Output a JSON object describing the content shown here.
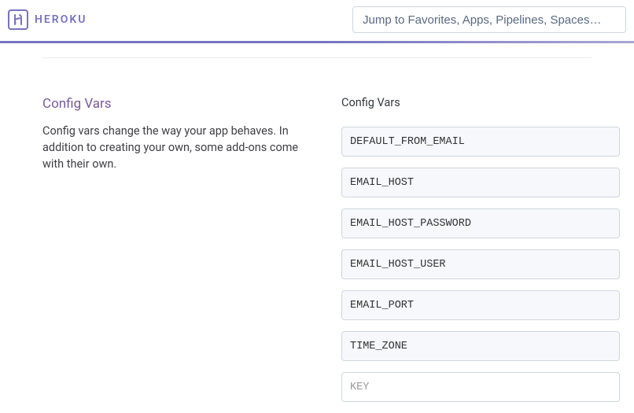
{
  "header": {
    "brand": "HEROKU",
    "search_placeholder": "Jump to Favorites, Apps, Pipelines, Spaces…"
  },
  "sidebar": {
    "title": "Config Vars",
    "description": "Config vars change the way your app behaves. In addition to creating your own, some add-ons come with their own."
  },
  "config": {
    "heading": "Config Vars",
    "vars": [
      {
        "key": "DEFAULT_FROM_EMAIL"
      },
      {
        "key": "EMAIL_HOST"
      },
      {
        "key": "EMAIL_HOST_PASSWORD"
      },
      {
        "key": "EMAIL_HOST_USER"
      },
      {
        "key": "EMAIL_PORT"
      },
      {
        "key": "TIME_ZONE"
      }
    ],
    "new_key_placeholder": "KEY"
  }
}
